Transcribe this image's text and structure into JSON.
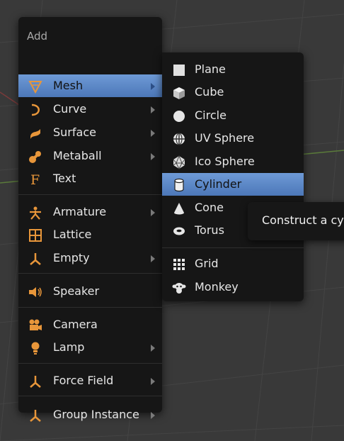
{
  "add_menu": {
    "title": "Add",
    "items": [
      {
        "label": "Mesh",
        "icon": "mesh-icon",
        "submenu": true
      },
      {
        "label": "Curve",
        "icon": "curve-icon",
        "submenu": true
      },
      {
        "label": "Surface",
        "icon": "surface-icon",
        "submenu": true
      },
      {
        "label": "Metaball",
        "icon": "metaball-icon",
        "submenu": true
      },
      {
        "label": "Text",
        "icon": "text-icon",
        "submenu": false
      },
      {
        "label": "Armature",
        "icon": "armature-icon",
        "submenu": true
      },
      {
        "label": "Lattice",
        "icon": "lattice-icon",
        "submenu": false
      },
      {
        "label": "Empty",
        "icon": "empty-icon",
        "submenu": true
      },
      {
        "label": "Speaker",
        "icon": "speaker-icon",
        "submenu": false
      },
      {
        "label": "Camera",
        "icon": "camera-icon",
        "submenu": false
      },
      {
        "label": "Lamp",
        "icon": "lamp-icon",
        "submenu": true
      },
      {
        "label": "Force Field",
        "icon": "force-field-icon",
        "submenu": true
      },
      {
        "label": "Group Instance",
        "icon": "group-instance-icon",
        "submenu": true
      }
    ]
  },
  "mesh_menu": {
    "items": [
      {
        "label": "Plane",
        "icon": "plane-icon"
      },
      {
        "label": "Cube",
        "icon": "cube-icon"
      },
      {
        "label": "Circle",
        "icon": "circle-icon"
      },
      {
        "label": "UV Sphere",
        "icon": "uv-sphere-icon"
      },
      {
        "label": "Ico Sphere",
        "icon": "ico-sphere-icon"
      },
      {
        "label": "Cylinder",
        "icon": "cylinder-icon"
      },
      {
        "label": "Cone",
        "icon": "cone-icon"
      },
      {
        "label": "Torus",
        "icon": "torus-icon"
      },
      {
        "label": "Grid",
        "icon": "grid-icon"
      },
      {
        "label": "Monkey",
        "icon": "monkey-icon"
      }
    ]
  },
  "tooltip": {
    "text": "Construct a cy"
  },
  "colors": {
    "highlight": "#5a86c6",
    "icon_orange": "#e59a3b",
    "menu_bg": "#161616"
  }
}
